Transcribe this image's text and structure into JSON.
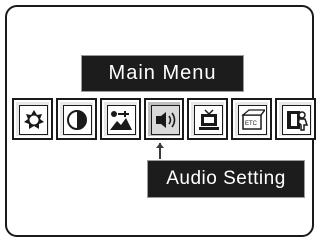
{
  "menu": {
    "title": "Main Menu",
    "items": [
      {
        "name": "brightness",
        "icon": "brightness-sun-icon"
      },
      {
        "name": "contrast",
        "icon": "contrast-half-circle-icon"
      },
      {
        "name": "picture",
        "icon": "picture-landscape-icon"
      },
      {
        "name": "audio",
        "icon": "speaker-icon",
        "selected": true
      },
      {
        "name": "tv",
        "icon": "television-icon"
      },
      {
        "name": "etc",
        "icon": "etc-box-icon",
        "label": "ETC"
      },
      {
        "name": "setup",
        "icon": "setup-person-icon"
      }
    ],
    "selected_item_label": "Audio Setting"
  },
  "colors": {
    "panel_bg": "#1c1c1c",
    "panel_text": "#ffffff",
    "frame_border": "#1a1a1a",
    "tab_bg": "#e8e8e8",
    "tab_selected_bg": "#bfbfbf"
  }
}
